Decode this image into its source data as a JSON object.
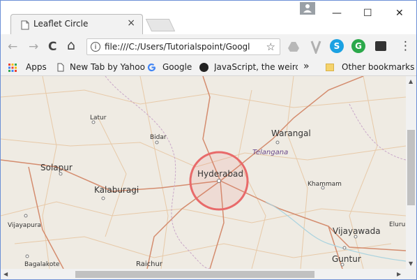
{
  "window": {
    "tab_title": "Leaflet Circle",
    "tab_close": "×",
    "minimize": "—",
    "maximize": "☐",
    "close": "✕"
  },
  "toolbar": {
    "back": "←",
    "forward": "→",
    "reload": "C",
    "home": "⌂",
    "info": "i",
    "url": "file:///C:/Users/Tutorialspoint/Googl",
    "star": "☆",
    "menu": "⋮"
  },
  "bookmarks": {
    "apps": "Apps",
    "items": [
      "New Tab by Yahoo",
      "Google",
      "JavaScript, the weird"
    ],
    "overflow": "»",
    "other": "Other bookmarks"
  },
  "map": {
    "cities": [
      "Latur",
      "Bidar",
      "Warangal",
      "Telangana",
      "Solapur",
      "Hyderabad",
      "Kalaburagi",
      "Khammam",
      "Vijayapura",
      "Vijayawada",
      "Eluru",
      "Bagalakote",
      "Raichur",
      "Guntur"
    ],
    "circle_color": "#e86a6a"
  },
  "colors": {
    "accent_blue": "#6b8fd6",
    "google_blue": "#4285f4",
    "skype": "#1ba1e2",
    "green_ext": "#2ba84a"
  }
}
